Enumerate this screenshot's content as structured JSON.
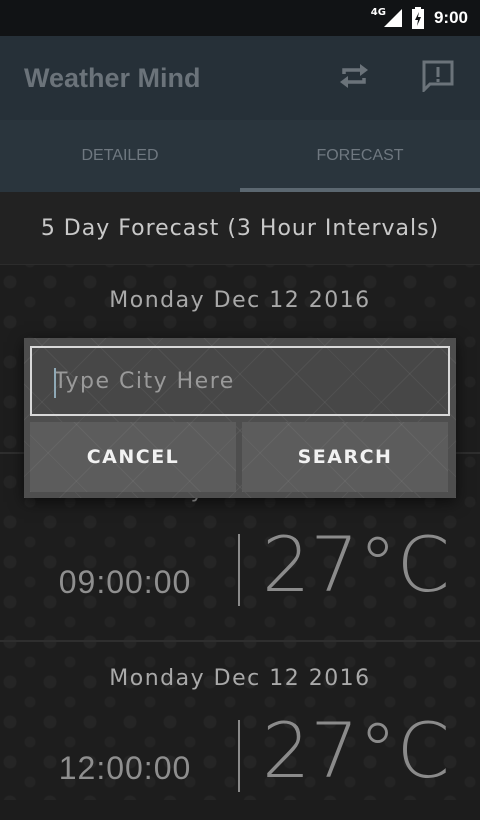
{
  "status_bar": {
    "network": "4G",
    "time": "9:00"
  },
  "app_bar": {
    "title": "Weather Mind"
  },
  "tabs": [
    {
      "label": "DETAILED",
      "active": false
    },
    {
      "label": "FORECAST",
      "active": true
    }
  ],
  "section": {
    "title": "5 Day Forecast (3 Hour Intervals)"
  },
  "forecast": {
    "entries": [
      {
        "date": "Monday Dec 12 2016"
      },
      {
        "date": "Monday Dec 12 2016",
        "time": "09:00:00",
        "temp": "27°C"
      },
      {
        "date": "Monday Dec 12 2016",
        "time": "12:00:00",
        "temp": "27°C"
      }
    ]
  },
  "dialog": {
    "placeholder": "Type City Here",
    "cancel_label": "CANCEL",
    "search_label": "SEARCH"
  },
  "colors": {
    "app_bar": "#263038",
    "tabs": "#2a353d",
    "background": "#1c1c1c",
    "dialog": "#4e4e4e"
  }
}
